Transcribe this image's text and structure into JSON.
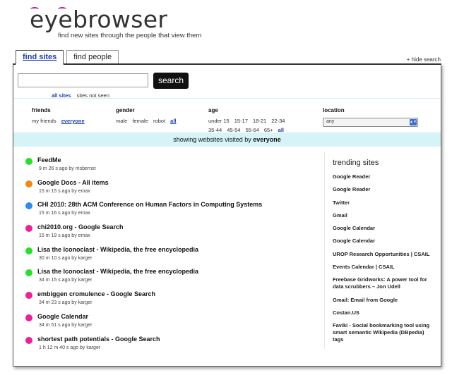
{
  "header": {
    "logo_text": "eyebrowser",
    "tagline": "find new sites through the people that view them"
  },
  "tabs": [
    {
      "label": "find sites",
      "active": true
    },
    {
      "label": "find people",
      "active": false
    }
  ],
  "hide_search": "+ hide search",
  "search": {
    "value": "",
    "placeholder": "",
    "button_label": "search",
    "scope_all": "all sites",
    "scope_unseen": "sites not seen"
  },
  "filters": {
    "friends": {
      "title": "friends",
      "options": [
        "my friends",
        "everyone"
      ],
      "selected": "everyone"
    },
    "gender": {
      "title": "gender",
      "options": [
        "male",
        "female",
        "robot",
        "all"
      ],
      "selected": "all"
    },
    "age": {
      "title": "age",
      "row1": [
        "under 15",
        "15-17",
        "18-21",
        "22-34"
      ],
      "row2": [
        "35-44",
        "45-54",
        "55-64",
        "65+",
        "all"
      ],
      "selected": "all"
    },
    "location": {
      "title": "location",
      "selected": "any"
    }
  },
  "showing": {
    "prefix": "showing websites visited by",
    "who": "everyone"
  },
  "results": [
    {
      "title": "FeedMe",
      "meta": "9 m 26 s ago by msbernst",
      "color": "#2adf2a"
    },
    {
      "title": "Google Docs - All items",
      "meta": "15 m 15 s ago by emax",
      "color": "#f08a10"
    },
    {
      "title": "CHI 2010: 28th ACM Conference on Human Factors in Computing Systems",
      "meta": "15 m 16 s ago by emax",
      "color": "#2a8ef0"
    },
    {
      "title": "chi2010.org - Google Search",
      "meta": "15 m 19 s ago by emax",
      "color": "#ee1f9a"
    },
    {
      "title": "Lisa the Iconoclast - Wikipedia, the free encyclopedia",
      "meta": "30 m 10 s ago by karger",
      "color": "#2adf2a"
    },
    {
      "title": "Lisa the Iconoclast - Wikipedia, the free encyclopedia",
      "meta": "34 m 15 s ago by karger",
      "color": "#2adf2a"
    },
    {
      "title": "embiggen cromulence - Google Search",
      "meta": "34 m 23 s ago by karger",
      "color": "#ee1f9a"
    },
    {
      "title": "Google Calendar",
      "meta": "34 m 51 s ago by karger",
      "color": "#ee1f9a"
    },
    {
      "title": "shortest path potentials - Google Search",
      "meta": "1 h 12 m 40 s ago by karger",
      "color": "#ee1f9a"
    }
  ],
  "trending": {
    "title": "trending sites",
    "items": [
      "Google Reader",
      "Google Reader",
      "Twitter",
      "Gmail",
      "Google Calendar",
      "Google Calendar",
      "UROP Research Opportunities | CSAIL",
      "Events Calendar | CSAIL",
      "Freebase Gridworks: A power tool for data scrubbers – Jon Udell",
      "Gmail: Email from Google",
      "Costan.US",
      "Faviki - Social bookmarking tool using smart semantic Wikipedia (DBpedia) tags"
    ]
  }
}
